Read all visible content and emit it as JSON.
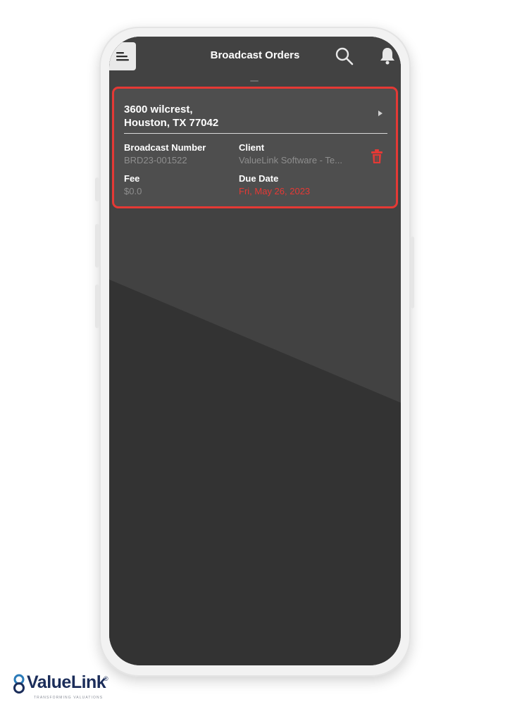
{
  "header": {
    "title": "Broadcast Orders"
  },
  "order": {
    "address_line1": "3600 wilcrest,",
    "address_line2": "Houston, TX 77042",
    "broadcast_number_label": "Broadcast Number",
    "broadcast_number": "BRD23-001522",
    "client_label": "Client",
    "client": "ValueLink Software - Te...",
    "fee_label": "Fee",
    "fee": "$0.0",
    "due_date_label": "Due Date",
    "due_date": "Fri, May 26, 2023"
  },
  "branding": {
    "logo_text": "ValueLink",
    "registered_mark": "®",
    "tagline": "TRANSFORMING VALUATIONS"
  },
  "icons": {
    "menu": "hamburger-icon",
    "search": "search-icon",
    "notifications": "bell-icon",
    "expand": "chevron-right-icon",
    "delete": "trash-icon",
    "logo": "valuelink-logo-icon"
  },
  "colors": {
    "screen_background": "#333333",
    "card_background": "#4e4e4e",
    "highlight_border": "#e53935",
    "accent_red": "#e53935",
    "muted_text": "#8e8e8e",
    "brand_navy": "#1b2d5a"
  }
}
